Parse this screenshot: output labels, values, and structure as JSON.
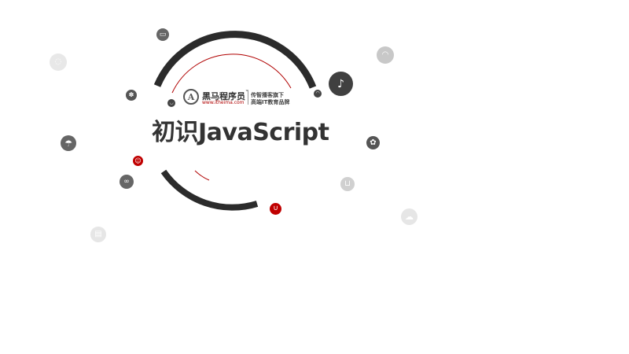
{
  "slide": {
    "title": "初识JavaScript"
  },
  "logo": {
    "mark": "A",
    "name": "黑马程序员",
    "trademark": "™",
    "url": "www.itheima.com",
    "slogan_line1": "传智播客旗下",
    "slogan_line2": "高端IT教育品牌"
  },
  "colors": {
    "ring": "#2b2b2b",
    "thin_arc": "#b00000",
    "accent_red": "#c00000",
    "bubble_dark": "#555555",
    "bubble_light": "#d9d9d9",
    "title_text": "#333333"
  },
  "bubble_icons": [
    "tv-icon",
    "chat-icon",
    "dish-icon",
    "megaphone-icon",
    "paw-icon",
    "coffee-icon",
    "shirt-icon",
    "hanger-icon",
    "umbrella-icon",
    "gear-icon",
    "printer-icon",
    "binoculars-icon",
    "smile-icon",
    "cart-icon",
    "cloud-icon",
    "truck-icon",
    "magnet-icon"
  ]
}
